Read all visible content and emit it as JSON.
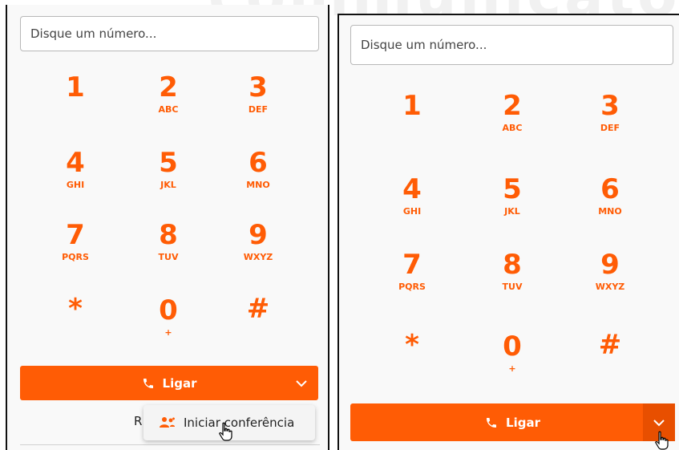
{
  "watermark": "communicator",
  "left_panel": {
    "input_placeholder": "Disque um número...",
    "call_label": "Ligar",
    "partial_text": "R",
    "dropdown_item": "Iniciar conferência"
  },
  "right_panel": {
    "input_placeholder": "Disque um número...",
    "call_label": "Ligar"
  },
  "keypad": [
    {
      "digit": "1",
      "letters": ""
    },
    {
      "digit": "2",
      "letters": "ABC"
    },
    {
      "digit": "3",
      "letters": "DEF"
    },
    {
      "digit": "4",
      "letters": "GHI"
    },
    {
      "digit": "5",
      "letters": "JKL"
    },
    {
      "digit": "6",
      "letters": "MNO"
    },
    {
      "digit": "7",
      "letters": "PQRS"
    },
    {
      "digit": "8",
      "letters": "TUV"
    },
    {
      "digit": "9",
      "letters": "WXYZ"
    },
    {
      "digit": "*",
      "letters": ""
    },
    {
      "digit": "0",
      "letters": "+"
    },
    {
      "digit": "#",
      "letters": ""
    }
  ],
  "colors": {
    "accent": "#ff5c05",
    "panel_bg": "#f9f9f9"
  }
}
